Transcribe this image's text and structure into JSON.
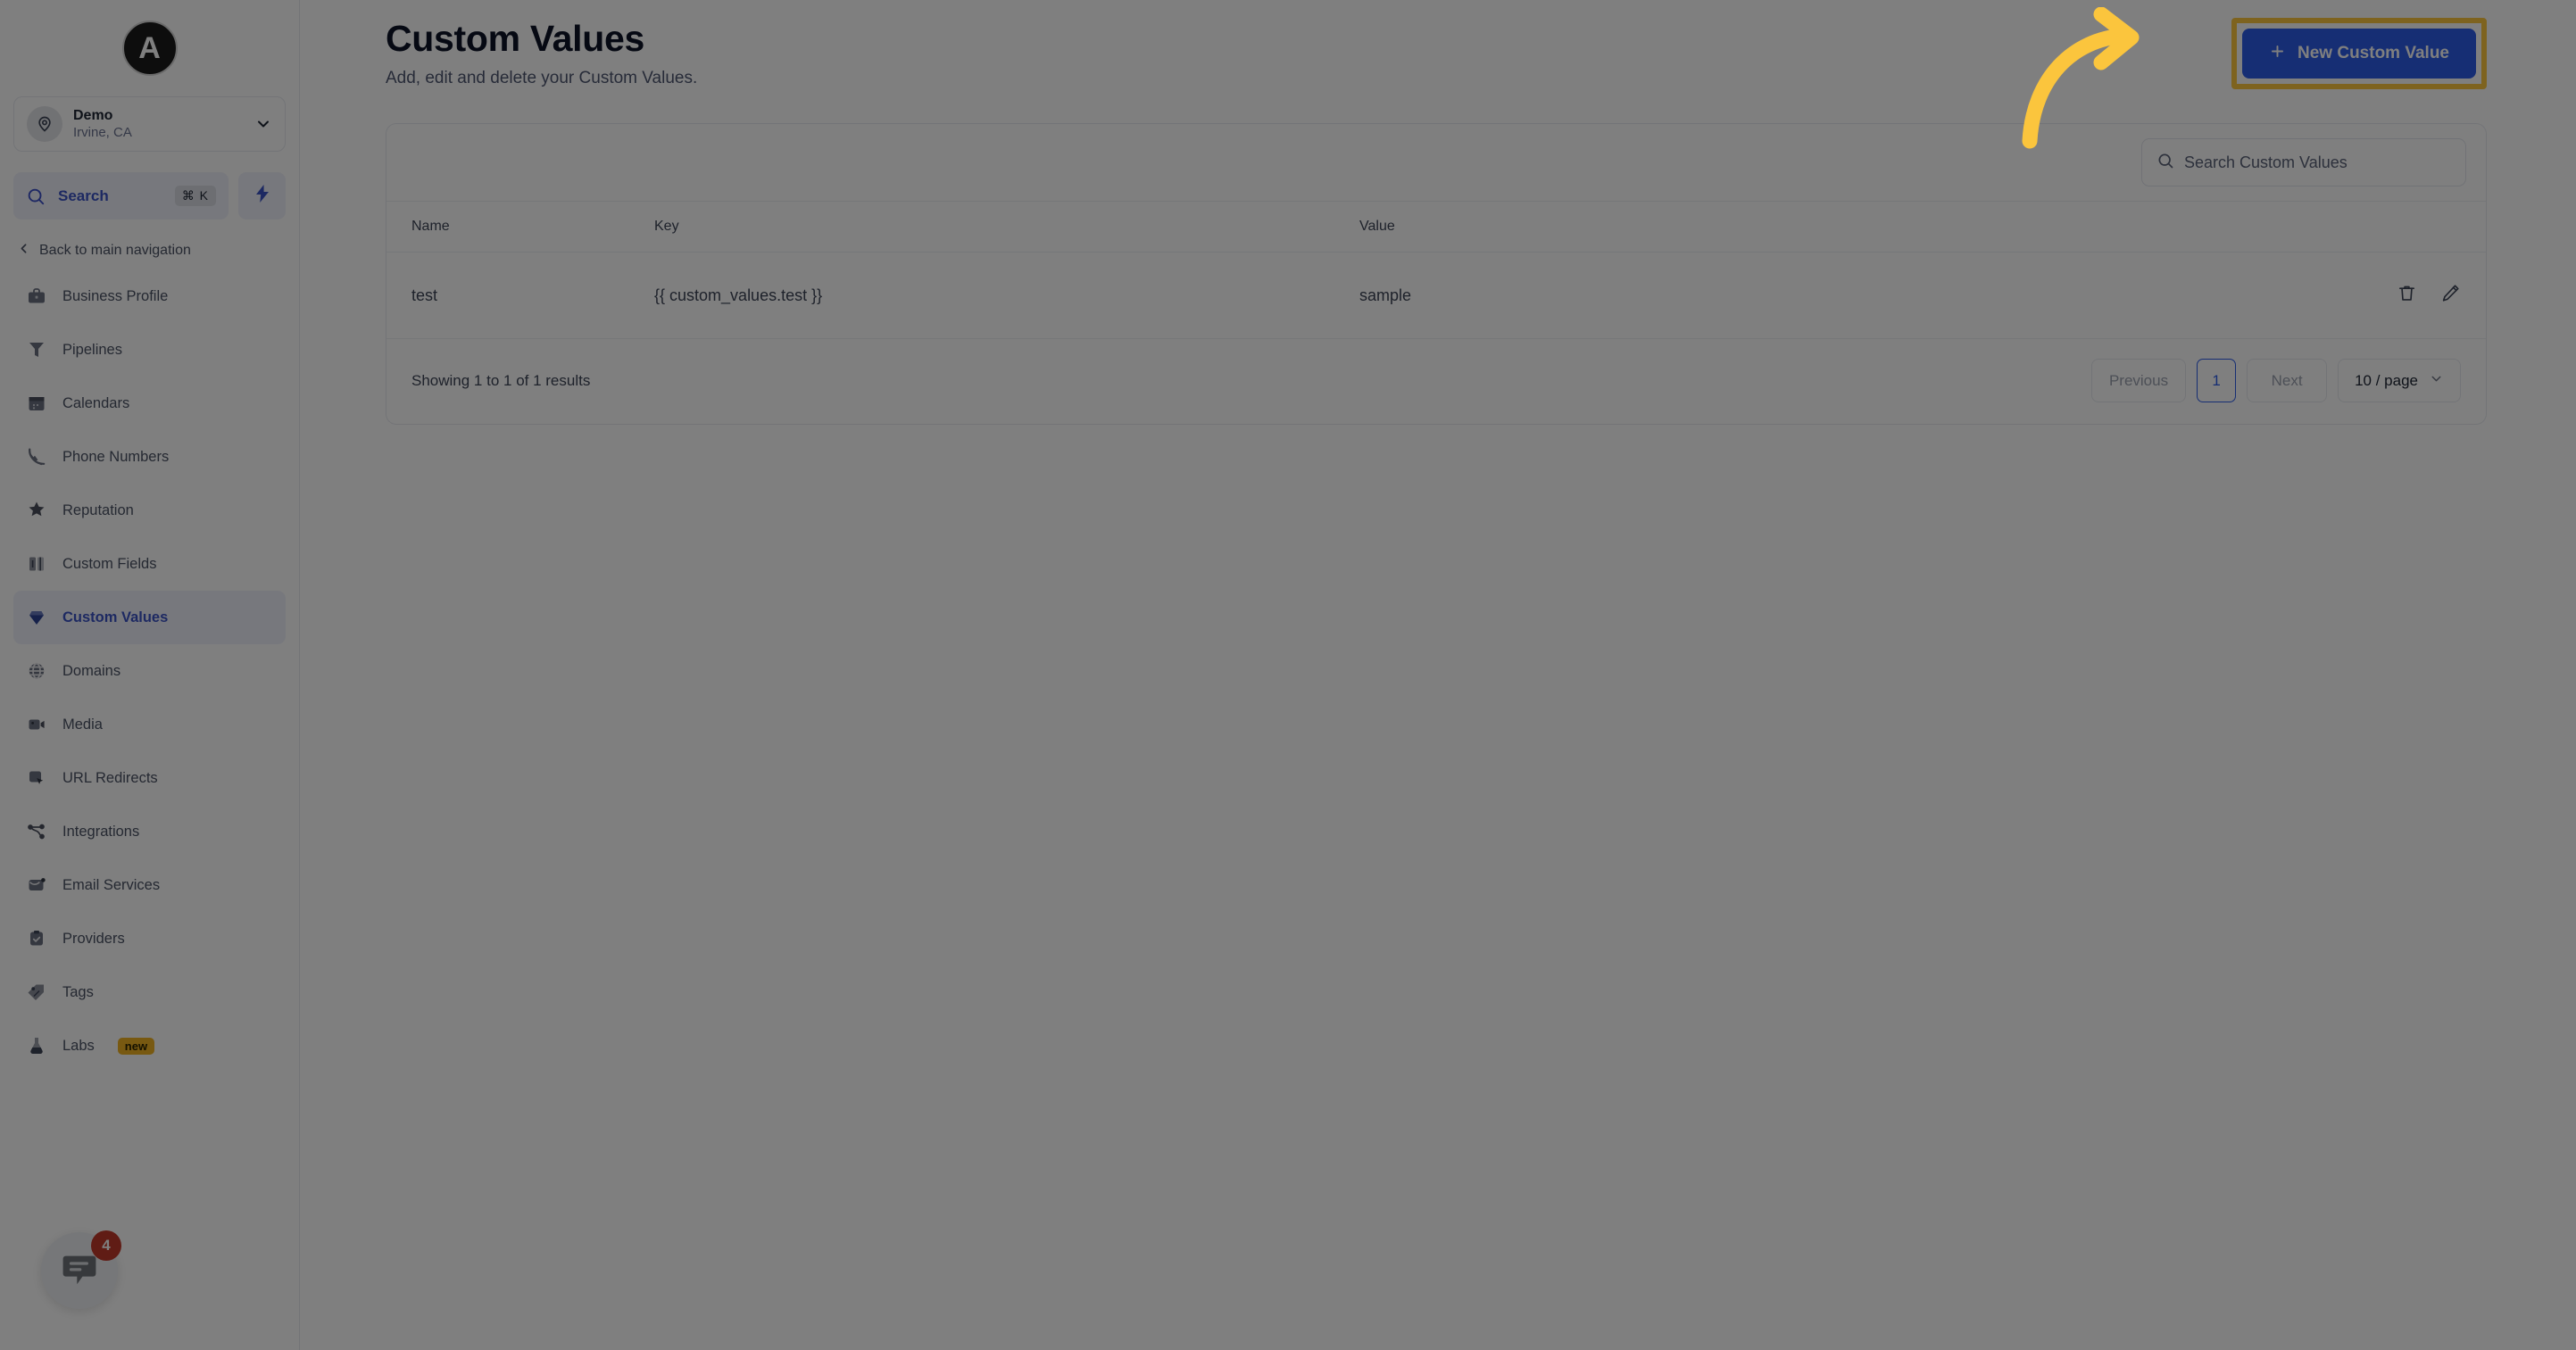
{
  "sidebar": {
    "logo_letter": "A",
    "location": {
      "icon": "map-pin-icon",
      "name": "Demo",
      "sub": "Irvine, CA",
      "chevron": "chevron-down-icon"
    },
    "search": {
      "icon": "search-icon",
      "label": "Search",
      "shortcut": "⌘ K",
      "bolt_icon": "lightning-bolt-icon"
    },
    "back_nav": {
      "icon": "chevron-left-icon",
      "label": "Back to main navigation"
    },
    "items": [
      {
        "icon": "briefcase-icon",
        "label": "Business Profile",
        "active": false
      },
      {
        "icon": "funnel-icon",
        "label": "Pipelines",
        "active": false
      },
      {
        "icon": "calendar-icon",
        "label": "Calendars",
        "active": false
      },
      {
        "icon": "phone-icon",
        "label": "Phone Numbers",
        "active": false
      },
      {
        "icon": "star-sparkle-icon",
        "label": "Reputation",
        "active": false
      },
      {
        "icon": "columns-icon",
        "label": "Custom Fields",
        "active": false
      },
      {
        "icon": "gem-icon",
        "label": "Custom Values",
        "active": true
      },
      {
        "icon": "globe-icon",
        "label": "Domains",
        "active": false
      },
      {
        "icon": "video-camera-icon",
        "label": "Media",
        "active": false
      },
      {
        "icon": "cursor-click-icon",
        "label": "URL Redirects",
        "active": false
      },
      {
        "icon": "nodes-icon",
        "label": "Integrations",
        "active": false
      },
      {
        "icon": "envelope-icon",
        "label": "Email Services",
        "active": false
      },
      {
        "icon": "clipboard-check-icon",
        "label": "Providers",
        "active": false
      },
      {
        "icon": "tag-icon",
        "label": "Tags",
        "active": false
      },
      {
        "icon": "flask-icon",
        "label": "Labs",
        "active": false,
        "badge": "new"
      }
    ],
    "chat": {
      "icon": "chat-bubble-icon",
      "unread": "4"
    }
  },
  "header": {
    "title": "Custom Values",
    "subtitle": "Add, edit and delete your Custom Values.",
    "new_button": {
      "plus_icon": "plus-icon",
      "label": "New Custom Value"
    }
  },
  "annotation": {
    "arrow_icon": "curved-arrow-icon",
    "arrow_color": "#fbc53d",
    "highlight_color": "#fcc63f"
  },
  "table": {
    "search": {
      "icon": "search-icon",
      "placeholder": "Search Custom Values",
      "value": ""
    },
    "columns": [
      "Name",
      "Key",
      "Value",
      ""
    ],
    "rows": [
      {
        "name": "test",
        "key": "{{ custom_values.test }}",
        "value": "sample",
        "actions": [
          "trash-icon",
          "pencil-icon"
        ]
      }
    ],
    "footer": {
      "results": "Showing 1 to 1 of 1 results",
      "previous": "Previous",
      "page": "1",
      "next": "Next",
      "page_size": "10 / page",
      "page_size_chevron": "chevron-down-icon"
    }
  },
  "colors": {
    "primary": "#2c5ce8",
    "accent_yellow": "#fbc53d",
    "sidebar_active_bg": "#eef1fb",
    "sidebar_active_text": "#3b53c4",
    "badge_new_bg": "#f0b323",
    "chat_badge_bg": "#c0392b"
  }
}
